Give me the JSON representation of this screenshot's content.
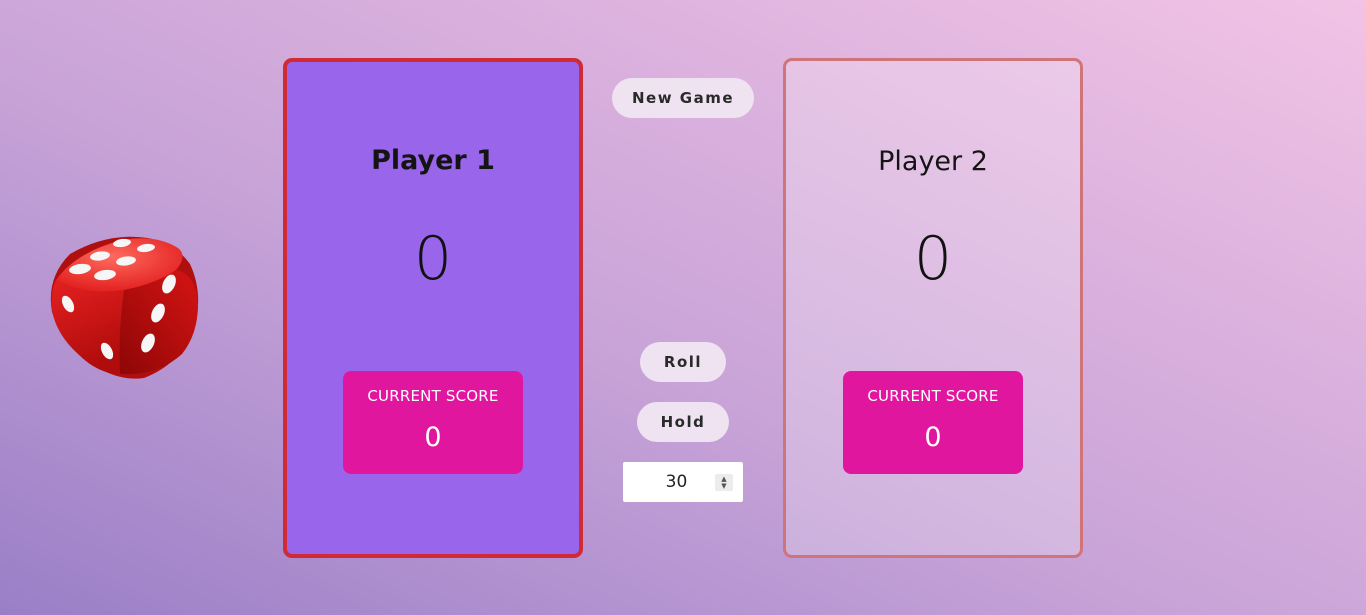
{
  "players": [
    {
      "name": "Player 1",
      "total_score": "0",
      "current_label": "CURRENT SCORE",
      "current_score": "0",
      "active": true
    },
    {
      "name": "Player 2",
      "total_score": "0",
      "current_label": "CURRENT SCORE",
      "current_score": "0",
      "active": false
    }
  ],
  "controls": {
    "new_game_label": "New Game",
    "roll_label": "Roll",
    "hold_label": "Hold",
    "target_score": "30"
  },
  "dice": {
    "icon": "dice-icon",
    "color": "#d8181d"
  },
  "colors": {
    "active_panel": "#9865eb",
    "active_border": "#d12a37",
    "current_score_box": "#e1169f"
  }
}
